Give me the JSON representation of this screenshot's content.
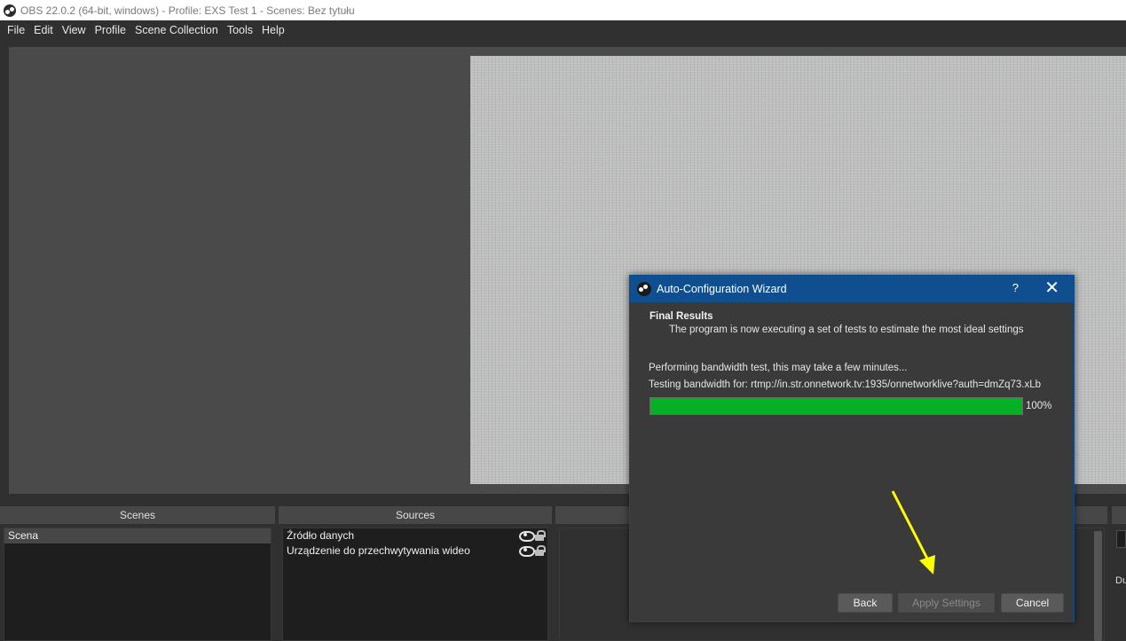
{
  "window": {
    "title": "OBS 22.0.2 (64-bit, windows) - Profile: EXS Test 1 - Scenes: Bez tytułu"
  },
  "menu": {
    "items": [
      "File",
      "Edit",
      "View",
      "Profile",
      "Scene Collection",
      "Tools",
      "Help"
    ]
  },
  "docks": {
    "scenes": {
      "header": "Scenes",
      "items": [
        "Scena"
      ]
    },
    "sources": {
      "header": "Sources",
      "items": [
        "Źródło danych",
        "Urządzenie do przechwytywania wideo"
      ]
    },
    "right_partial_label": "Du"
  },
  "wizard": {
    "title": "Auto-Configuration Wizard",
    "help": "?",
    "close": "✕",
    "heading": "Final Results",
    "subheading": "The program is now executing a set of tests to estimate the most ideal settings",
    "status": "Performing bandwidth test, this may take a few minutes...",
    "testing": "Testing bandwidth for:  rtmp://in.str.onnetwork.tv:1935/onnetworklive?auth=dmZq73.xLb",
    "progress_fraction": 1.0,
    "progress_label": "100%",
    "buttons": {
      "back": "Back",
      "apply": "Apply Settings",
      "cancel": "Cancel"
    }
  },
  "colors": {
    "progress": "#06b025",
    "wizard_title": "#0f4f8f",
    "annotation_arrow": "#ffff00"
  },
  "icons": {
    "app": "obs-logo-icon",
    "visibility": "eye-icon",
    "lock": "lock-icon"
  }
}
